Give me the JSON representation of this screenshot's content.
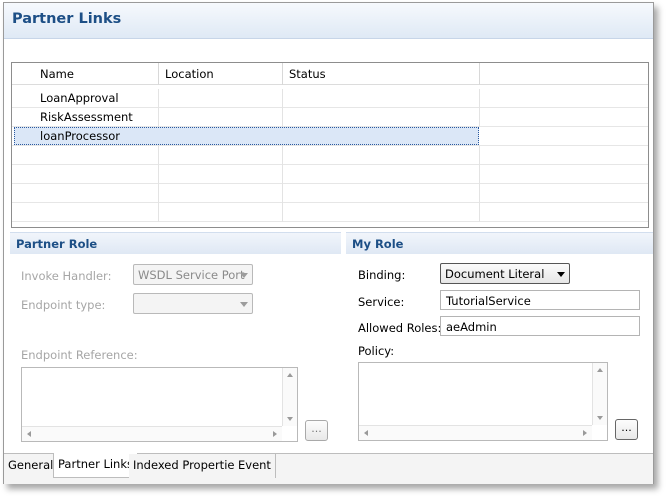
{
  "header": {
    "title": "Partner Links"
  },
  "table": {
    "columns": [
      "Name",
      "Location",
      "Status"
    ],
    "rows": [
      {
        "name": "LoanApproval",
        "location": "",
        "status": ""
      },
      {
        "name": "RiskAssessment",
        "location": "",
        "status": ""
      },
      {
        "name": "loanProcessor",
        "location": "",
        "status": ""
      }
    ],
    "selected_row": "loanProcessor"
  },
  "partner_role": {
    "title": "Partner Role",
    "invoke_handler_label": "Invoke Handler:",
    "invoke_handler_value": "WSDL Service Port",
    "endpoint_type_label": "Endpoint type:",
    "endpoint_type_value": "",
    "endpoint_reference_label": "Endpoint Reference:",
    "browse_label": "..."
  },
  "my_role": {
    "title": "My Role",
    "binding_label": "Binding:",
    "binding_value": "Document Literal",
    "service_label": "Service:",
    "service_value": "TutorialService",
    "allowed_roles_label": "Allowed Roles:",
    "allowed_roles_value": "aeAdmin",
    "policy_label": "Policy:",
    "browse_label": "..."
  },
  "tabs": [
    "General",
    "Partner Links",
    "Indexed Properties",
    "Event"
  ],
  "active_tab": "Partner Links"
}
